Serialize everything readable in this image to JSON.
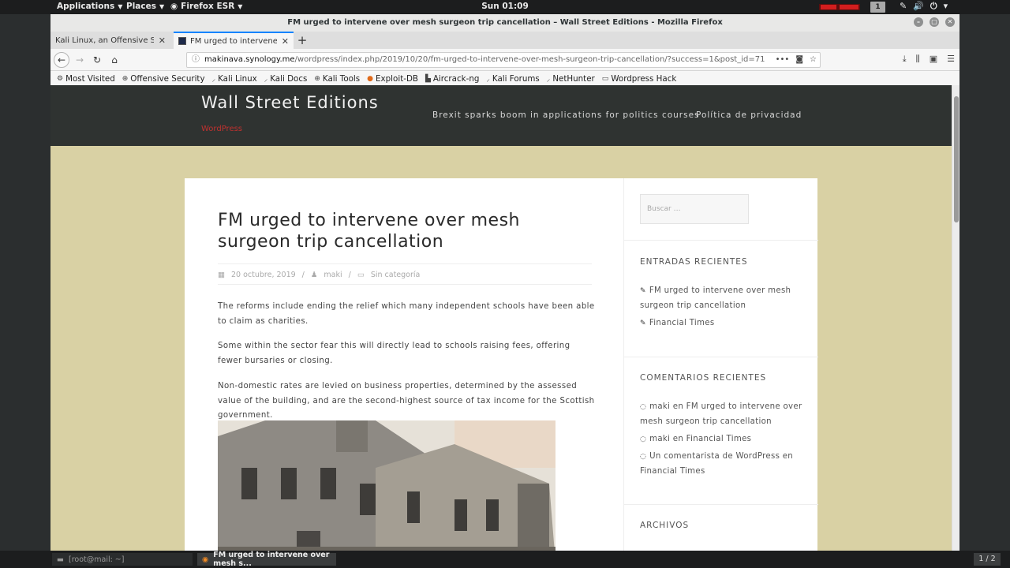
{
  "topbar": {
    "applications": "Applications",
    "places": "Places",
    "firefox": "Firefox ESR",
    "clock": "Sun 01:09",
    "workspace": "1"
  },
  "window": {
    "title": "FM urged to intervene over mesh surgeon trip cancellation – Wall Street Editions - Mozilla Firefox"
  },
  "tabs": [
    {
      "label": "Kali Linux, an Offensive Security"
    },
    {
      "label": "FM urged to intervene over mesh surgeon trip cancellation"
    }
  ],
  "url": {
    "host": "makinava.synology.me",
    "path": "/wordpress/index.php/2019/10/20/fm-urged-to-intervene-over-mesh-surgeon-trip-cancellation/?success=1&post_id=71"
  },
  "bookmarks": [
    {
      "label": "Most Visited",
      "icon": "gear-icon"
    },
    {
      "label": "Offensive Security",
      "icon": "globe-icon"
    },
    {
      "label": "Kali Linux",
      "icon": "kali-icon"
    },
    {
      "label": "Kali Docs",
      "icon": "kali-icon"
    },
    {
      "label": "Kali Tools",
      "icon": "globe-icon"
    },
    {
      "label": "Exploit-DB",
      "icon": "exploit-icon"
    },
    {
      "label": "Aircrack-ng",
      "icon": "aircrack-icon"
    },
    {
      "label": "Kali Forums",
      "icon": "kali-icon"
    },
    {
      "label": "NetHunter",
      "icon": "kali-icon"
    },
    {
      "label": "Wordpress Hack",
      "icon": "folder-icon"
    }
  ],
  "site": {
    "title": "Wall Street Editions",
    "description": "WordPress",
    "nav": [
      "Brexit sparks boom in applications for politics courses",
      "Política de privacidad"
    ]
  },
  "post": {
    "title": "FM urged to intervene over mesh surgeon trip cancellation",
    "date": "20 octubre, 2019",
    "author": "maki",
    "category": "Sin categoría",
    "paragraphs": [
      "The reforms include ending the relief which many independent schools have been able to claim as charities.",
      "Some within the sector fear this will directly lead to schools raising fees, offering fewer bursaries or closing.",
      "Non-domestic rates are levied on business properties, determined by the assessed value of the building, and are the second-highest source of tax income for the Scottish government."
    ]
  },
  "sidebar": {
    "search_placeholder": "Buscar …",
    "recent_posts_heading": "ENTRADAS RECIENTES",
    "recent_posts": [
      "FM urged to intervene over mesh surgeon trip cancellation",
      "Financial Times"
    ],
    "recent_comments_heading": "COMENTARIOS RECIENTES",
    "recent_comments": [
      "maki en FM urged to intervene over mesh surgeon trip cancellation",
      "maki en Financial Times",
      "Un comentarista de WordPress en Financial Times"
    ],
    "archives_heading": "ARCHIVOS"
  },
  "taskbar": {
    "terminal": "[root@mail: ~]",
    "firefox": "FM urged to intervene over mesh s...",
    "pager": "1 / 2"
  }
}
